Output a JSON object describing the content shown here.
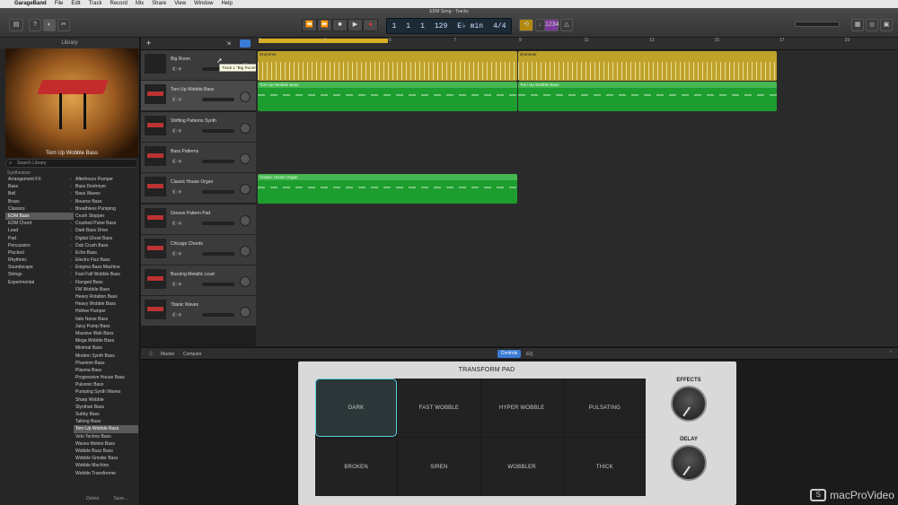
{
  "menubar": {
    "apple": "",
    "app": "GarageBand",
    "items": [
      "File",
      "Edit",
      "Track",
      "Record",
      "Mix",
      "Share",
      "View",
      "Window",
      "Help"
    ]
  },
  "window_title": "EDM Song - Tracks",
  "toolbar": {
    "lcd": {
      "bars": "1",
      "beat": "1",
      "division": "1",
      "bpm": "129",
      "key": "E♭ min",
      "signature": "4/4"
    },
    "transport": [
      "⏪",
      "⏩",
      "■",
      "▶",
      "●"
    ]
  },
  "library": {
    "title": "Library",
    "preview_caption": "Torn Up Wobble Bass",
    "search_placeholder": "Search Library",
    "crumb": "Synthesizer",
    "categories": [
      "Arrangement FX",
      "Bass",
      "Bell",
      "Brass",
      "Classics",
      "EDM Bass",
      "EDM Chord",
      "Lead",
      "Pad",
      "Percussion",
      "Plucked",
      "Rhythmic",
      "Soundscape",
      "Strings",
      "Experimental"
    ],
    "selected_category": "EDM Bass",
    "patches": [
      "Afterhours Pumper",
      "Bass Destroyer",
      "Bass Waves",
      "Bounce Bass",
      "Breathless Pumping",
      "Crush Stopper",
      "Crushed Pulse Bass",
      "Dark Bass Drive",
      "Digital Ghost Bass",
      "Dub Crush Bass",
      "Echo Bass",
      "Electro Fizz Bass",
      "Enigma Bass Machine",
      "Fast Fall Wobble Bass",
      "Flanged Bass",
      "FM Wobble Bass",
      "Heavy Rotation Bass",
      "Heavy Wobble Bass",
      "Hollow Pumper",
      "Italo Noise Bass",
      "Juicy Pump Bass",
      "Massive Wah Bass",
      "Mega Wobble Bass",
      "Minimal Bass",
      "Modern Synth Bass",
      "Phantom Bass",
      "Plasma Bass",
      "Progressive House Bass",
      "Pulsonic Bass",
      "Pumping Synth Waves",
      "Sharp Wobble",
      "Slynthan Bass",
      "Subby Bass",
      "Talking Bass",
      "Torn Up Wobble Bass",
      "Velo Techno Bass",
      "Waves Motion Bass",
      "Wobble Buzz Bass",
      "Wobble Grinder Bass",
      "Wobble Machine",
      "Wobble Transformer"
    ],
    "selected_patch": "Torn Up Wobble Bass",
    "footer": {
      "delete": "Delete",
      "save": "Save..."
    }
  },
  "tracks": [
    {
      "name": "Big Room",
      "type": "drum"
    },
    {
      "name": "Torn Up Wobble Bass",
      "type": "synth",
      "selected": true
    },
    {
      "name": "Shifting Patterns Synth",
      "type": "synth"
    },
    {
      "name": "Bass Patterns",
      "type": "synth"
    },
    {
      "name": "Classic House Organ",
      "type": "synth"
    },
    {
      "name": "Groove Pattern Pad",
      "type": "synth"
    },
    {
      "name": "Chicago Chords",
      "type": "synth"
    },
    {
      "name": "Buzzing Metallic Lead",
      "type": "synth"
    },
    {
      "name": "Titanic Waves",
      "type": "synth"
    }
  ],
  "tooltip": "Track 1 \"Big Room\"",
  "ruler": {
    "numbers": [
      "1",
      "3",
      "5",
      "7",
      "9",
      "11",
      "13",
      "15",
      "17",
      "19"
    ]
  },
  "regions": {
    "drummer1": "Drummer",
    "drummer2": "Drummer",
    "wobble1": "Torn Up Wobble Bass",
    "wobble2": "Torn Up Wobble Bass",
    "organ": "Classic House Organ"
  },
  "smart_controls": {
    "tabs": {
      "master": "Master",
      "compare": "Compare",
      "controls": "Controls",
      "eq": "EQ"
    },
    "panel_title": "TRANSFORM PAD",
    "pads": [
      "DARK",
      "FAST WOBBLE",
      "HYPER WOBBLE",
      "PULSATING",
      "BROKEN",
      "SIREN",
      "WOBBLER",
      "THICK"
    ],
    "active_pad": "DARK",
    "effects_label": "EFFECTS",
    "delay_label": "DELAY"
  },
  "watermark": "macProVideo"
}
